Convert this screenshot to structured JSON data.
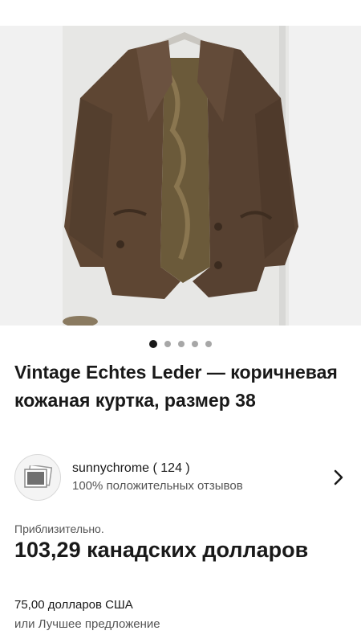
{
  "listing": {
    "title": "Vintage Echtes Leder — коричневая кожаная куртка, размер 38",
    "photo": {
      "icon": "leather-jacket-photo",
      "colors": {
        "jacket": "#5e4633",
        "lining": "#6b5a3a",
        "door": "#ececec"
      }
    },
    "carousel": {
      "count": 5,
      "active": 0
    }
  },
  "seller": {
    "name": "sunnychrome",
    "rating_text": "( 124 )",
    "feedback": "100% положительных отзывов",
    "avatar_icon": "photo-placeholder-icon"
  },
  "pricing": {
    "approx_label": "Приблизительно.",
    "price_local": "103,29 канадских долларов",
    "price_usd": "75,00 долларов США",
    "best_offer": "или Лучшее предложение"
  }
}
